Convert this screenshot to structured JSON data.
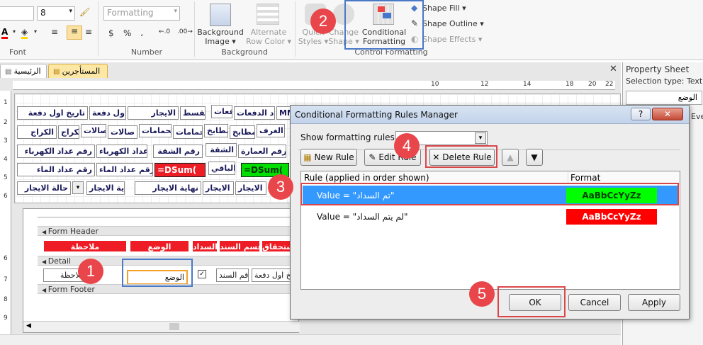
{
  "ribbon": {
    "font_size": "8",
    "font_group_label": "Font",
    "formatting_box": "Formatting",
    "number_group_label": "Number",
    "number_symbols": [
      "$",
      "%",
      "،",
      "←.0",
      ".00→"
    ],
    "background_image_label": "Background Image ▾",
    "alternate_row_color_label": "Alternate Row Color ▾",
    "background_group_label": "Background",
    "quick_styles_label": "Quick Styles ▾",
    "change_shape_label": "Change Shape ▾",
    "conditional_formatting_label": "Conditional Formatting",
    "shape_fill_label": "Shape Fill ▾",
    "shape_outline_label": "Shape Outline ▾",
    "shape_effects_label": "Shape Effects ▾",
    "control_formatting_group_label": "Control Formatting"
  },
  "tabs": [
    {
      "label": "الرئيسية"
    },
    {
      "label": "المستأجرين"
    }
  ],
  "form_top": {
    "row1": [
      "تاريخ اول دفعة",
      "تاريخ اول دفعة",
      "الايجار",
      "القسط",
      "دفعات",
      "عدد الدفعات",
      "MM"
    ],
    "row2": [
      "الكراج",
      "الكراج",
      "صالات",
      "صالات",
      "الحمامات",
      "الحمامات",
      "المطابخ",
      "مطابخ",
      "الغرف"
    ],
    "row3": [
      "رقم عداد الكهرباء",
      "رقم عداد الكهرباء",
      "رقم الشقة",
      "الشقة",
      "رقم العمارة"
    ],
    "row4": [
      "رقم عداد الماء",
      "رقم عداد الماء",
      "=DSum(",
      "الباقي",
      "=DSum("
    ],
    "row5": [
      "حالة الايجار",
      "بداية الايجار",
      "نهاية الايجار",
      "نهاية الايجار",
      "بداية الايجار"
    ]
  },
  "subform": {
    "form_header_label": "Form Header",
    "header_cells": [
      "ملاحظة",
      "الوضع",
      "السداد",
      "قسم السند",
      "الاستحقاق"
    ],
    "detail_label": "Detail",
    "detail_fields": [
      "ملاحظة",
      "الوضع",
      "قم السند",
      "تاريخ اول دفعة"
    ],
    "form_footer_label": "Form Footer"
  },
  "dialog": {
    "title": "Conditional Formatting Rules Manager",
    "help": "?",
    "close": "✕",
    "show_rules_label": "Show formatting rules for:",
    "show_rules_value": "",
    "new_rule": "New Rule",
    "edit_rule": "Edit Rule",
    "delete_rule": "Delete Rule",
    "col_rule": "Rule (applied in order shown)",
    "col_format": "Format",
    "rules": [
      {
        "condition": "Value = \"تم السداد\"",
        "sample": "AaBbCcYyZz",
        "bg": "#00ff00",
        "fg": "#004000",
        "selected": true
      },
      {
        "condition": "Value = \"لم يتم السداد\"",
        "sample": "AaBbCcYyZz",
        "bg": "#ff0000",
        "fg": "#ffffff",
        "selected": false
      }
    ],
    "ok": "OK",
    "cancel": "Cancel",
    "apply": "Apply"
  },
  "property_sheet": {
    "title": "Property Sheet",
    "selection_type": "Selection type: Text Ed",
    "selected_control": "الوضع",
    "partial_tab": "Eve"
  },
  "callouts": [
    "1",
    "2",
    "3",
    "4",
    "5"
  ],
  "colors": {
    "accent_blue": "#4a79c6",
    "callout_red": "#e8464a",
    "selected_row": "#3399ff",
    "header_red": "#ee1c24"
  }
}
